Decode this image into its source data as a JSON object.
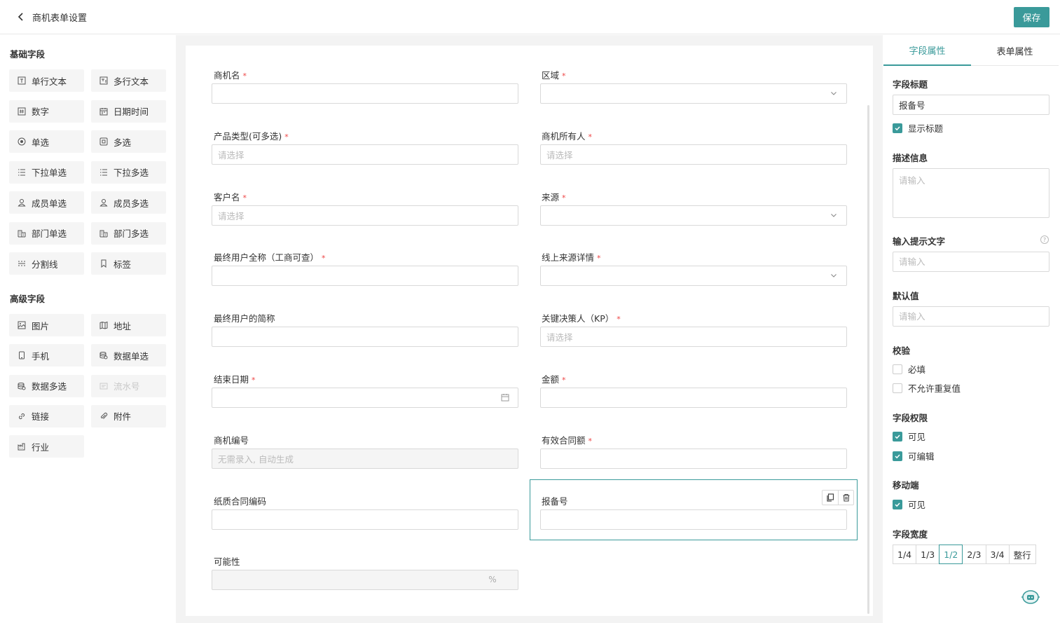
{
  "header": {
    "title": "商机表单设置",
    "save_label": "保存"
  },
  "left": {
    "basic_title": "基础字段",
    "basic_fields": [
      {
        "label": "单行文本",
        "icon": "single-line-text-icon"
      },
      {
        "label": "多行文本",
        "icon": "multi-line-text-icon"
      },
      {
        "label": "数字",
        "icon": "number-icon"
      },
      {
        "label": "日期时间",
        "icon": "calendar-icon"
      },
      {
        "label": "单选",
        "icon": "radio-icon"
      },
      {
        "label": "多选",
        "icon": "checkbox-icon"
      },
      {
        "label": "下拉单选",
        "icon": "list-icon"
      },
      {
        "label": "下拉多选",
        "icon": "list-icon"
      },
      {
        "label": "成员单选",
        "icon": "user-icon"
      },
      {
        "label": "成员多选",
        "icon": "user-icon"
      },
      {
        "label": "部门单选",
        "icon": "department-icon"
      },
      {
        "label": "部门多选",
        "icon": "department-icon"
      },
      {
        "label": "分割线",
        "icon": "divider-icon"
      },
      {
        "label": "标签",
        "icon": "bookmark-icon"
      }
    ],
    "advanced_title": "高级字段",
    "advanced_fields": [
      {
        "label": "图片",
        "icon": "image-icon"
      },
      {
        "label": "地址",
        "icon": "map-icon"
      },
      {
        "label": "手机",
        "icon": "phone-icon"
      },
      {
        "label": "数据单选",
        "icon": "database-icon"
      },
      {
        "label": "数据多选",
        "icon": "database-icon"
      },
      {
        "label": "流水号",
        "icon": "serial-icon",
        "disabled": true
      },
      {
        "label": "链接",
        "icon": "link-icon"
      },
      {
        "label": "附件",
        "icon": "attachment-icon"
      },
      {
        "label": "行业",
        "icon": "industry-icon"
      }
    ]
  },
  "form": {
    "fields": [
      {
        "label": "商机名",
        "required": true,
        "type": "text",
        "placeholder": ""
      },
      {
        "label": "区域",
        "required": true,
        "type": "select",
        "placeholder": ""
      },
      {
        "label": "产品类型(可多选)",
        "required": true,
        "type": "text",
        "placeholder": "请选择"
      },
      {
        "label": "商机所有人",
        "required": true,
        "type": "text",
        "placeholder": "请选择"
      },
      {
        "label": "客户名",
        "required": true,
        "type": "text",
        "placeholder": "请选择"
      },
      {
        "label": "来源",
        "required": true,
        "type": "select",
        "placeholder": ""
      },
      {
        "label": "最终用户全称（工商可查）",
        "required": true,
        "type": "text",
        "placeholder": ""
      },
      {
        "label": "线上来源详情",
        "required": true,
        "type": "select",
        "placeholder": ""
      },
      {
        "label": "最终用户的简称",
        "required": false,
        "type": "text",
        "placeholder": ""
      },
      {
        "label": "关键决策人（KP）",
        "required": true,
        "type": "text",
        "placeholder": "请选择"
      },
      {
        "label": "结束日期",
        "required": true,
        "type": "date",
        "placeholder": ""
      },
      {
        "label": "金额",
        "required": true,
        "type": "text",
        "placeholder": ""
      },
      {
        "label": "商机编号",
        "required": false,
        "type": "disabled",
        "placeholder": "无需录入, 自动生成"
      },
      {
        "label": "有效合同额",
        "required": true,
        "type": "text",
        "placeholder": ""
      },
      {
        "label": "纸质合同编码",
        "required": false,
        "type": "text",
        "placeholder": ""
      },
      {
        "label": "报备号",
        "required": false,
        "type": "text",
        "placeholder": "",
        "selected": true
      },
      {
        "label": "可能性",
        "required": false,
        "type": "percent",
        "placeholder": "",
        "suffix": "%"
      }
    ]
  },
  "props": {
    "tabs": [
      "字段属性",
      "表单属性"
    ],
    "active_tab": 0,
    "field_title_label": "字段标题",
    "field_title_value": "报备号",
    "show_title_label": "显示标题",
    "show_title_checked": true,
    "desc_label": "描述信息",
    "desc_placeholder": "请输入",
    "hint_label": "输入提示文字",
    "hint_placeholder": "请输入",
    "help_mark": "?",
    "default_label": "默认值",
    "default_placeholder": "请输入",
    "validate_label": "校验",
    "validate_options": [
      {
        "label": "必填",
        "checked": false
      },
      {
        "label": "不允许重复值",
        "checked": false
      }
    ],
    "perm_label": "字段权限",
    "perm_options": [
      {
        "label": "可见",
        "checked": true
      },
      {
        "label": "可编辑",
        "checked": true
      }
    ],
    "mobile_label": "移动端",
    "mobile_options": [
      {
        "label": "可见",
        "checked": true
      }
    ],
    "width_label": "字段宽度",
    "width_options": [
      "1/4",
      "1/3",
      "1/2",
      "2/3",
      "3/4",
      "整行"
    ],
    "width_active": 2
  },
  "colors": {
    "accent": "#3a9a9a",
    "required": "#ee4444"
  }
}
